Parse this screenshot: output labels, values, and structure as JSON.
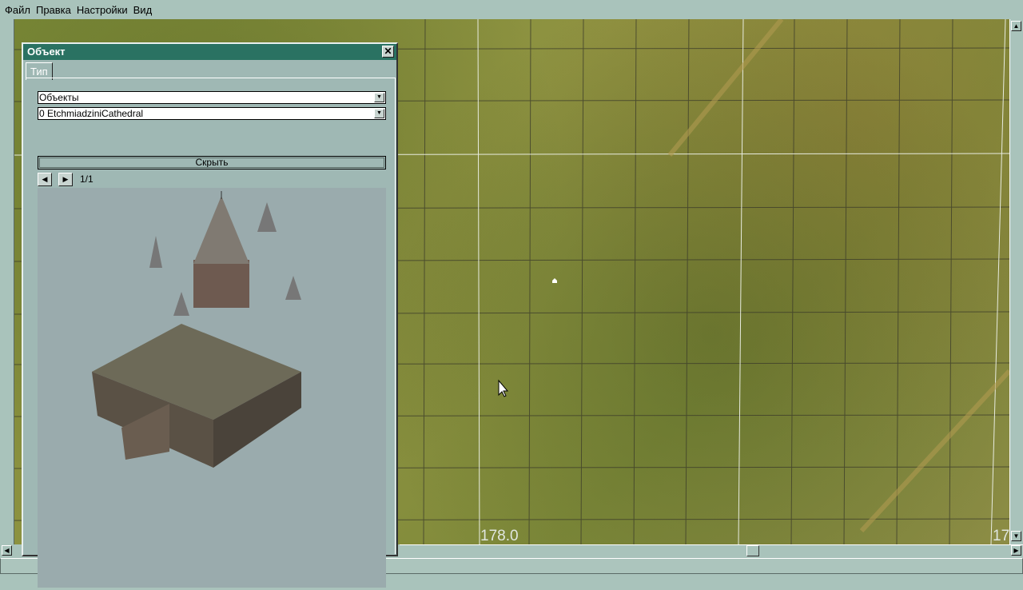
{
  "menu": [
    "Файл",
    "Правка",
    "Настройки",
    "Вид"
  ],
  "panel": {
    "title": "Объект",
    "tab": "Тип",
    "category": "Объекты",
    "object": "0 EtchmiadziniCathedral",
    "hide_label": "Скрыть",
    "page": "1/1"
  },
  "map": {
    "labels": [
      "178.0",
      "17"
    ]
  }
}
